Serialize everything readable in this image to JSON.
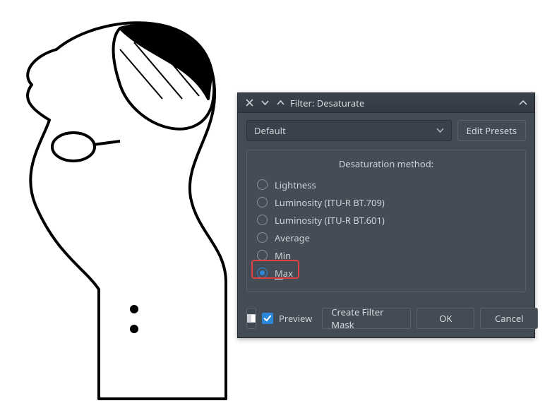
{
  "titlebar": {
    "title": "Filter: Desaturate"
  },
  "preset": {
    "selected": "Default",
    "edit_label": "Edit Presets"
  },
  "group": {
    "title": "Desaturation method:",
    "options": [
      {
        "label": "Lightness",
        "checked": false
      },
      {
        "label": "Luminosity (ITU-R BT.709)",
        "checked": false
      },
      {
        "label": "Luminosity (ITU-R BT.601)",
        "checked": false
      },
      {
        "label": "Average",
        "checked": false
      },
      {
        "label": "Min",
        "checked": false
      },
      {
        "label": "Max",
        "checked": true,
        "mnemonic": "M"
      }
    ]
  },
  "footer": {
    "preview_label": "Preview",
    "preview_checked": true,
    "create_mask": "Create Filter Mask",
    "ok": "OK",
    "cancel": "Cancel"
  }
}
